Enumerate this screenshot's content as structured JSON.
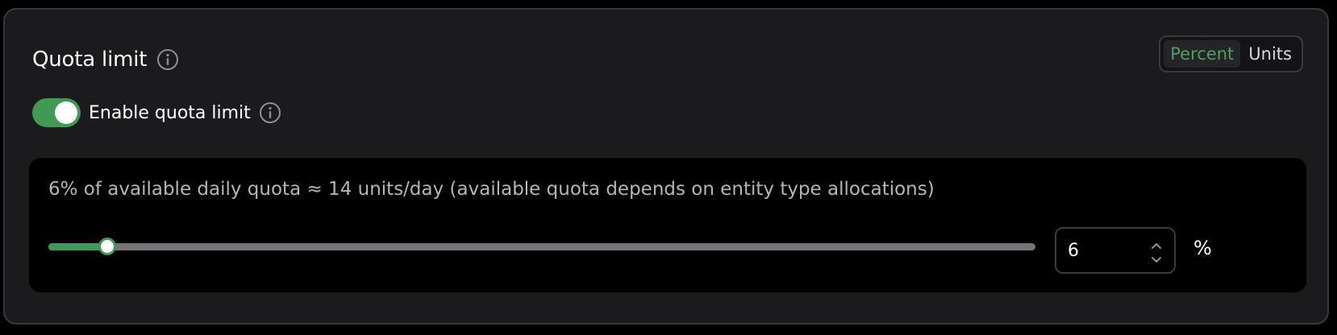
{
  "card": {
    "title": "Quota limit",
    "mode_toggle": {
      "options": [
        "Percent",
        "Units"
      ],
      "selected": "Percent"
    },
    "enable": {
      "label": "Enable quota limit",
      "enabled": true
    },
    "panel": {
      "description": "6% of available daily quota ≈ 14 units/day (available quota depends on entity type allocations)",
      "slider": {
        "value": 6,
        "min": 0,
        "max": 100
      },
      "input": {
        "value": "6"
      },
      "unit": "%"
    }
  },
  "colors": {
    "accent": "#3f9a55",
    "accent_text": "#4e9e62",
    "card_bg": "#1b1b1d",
    "panel_bg": "#000000",
    "track": "#757579"
  },
  "icons": {
    "title_info": "info-icon",
    "toggle_info": "info-icon",
    "stepper_up": "chevron-up-icon",
    "stepper_down": "chevron-down-icon"
  }
}
